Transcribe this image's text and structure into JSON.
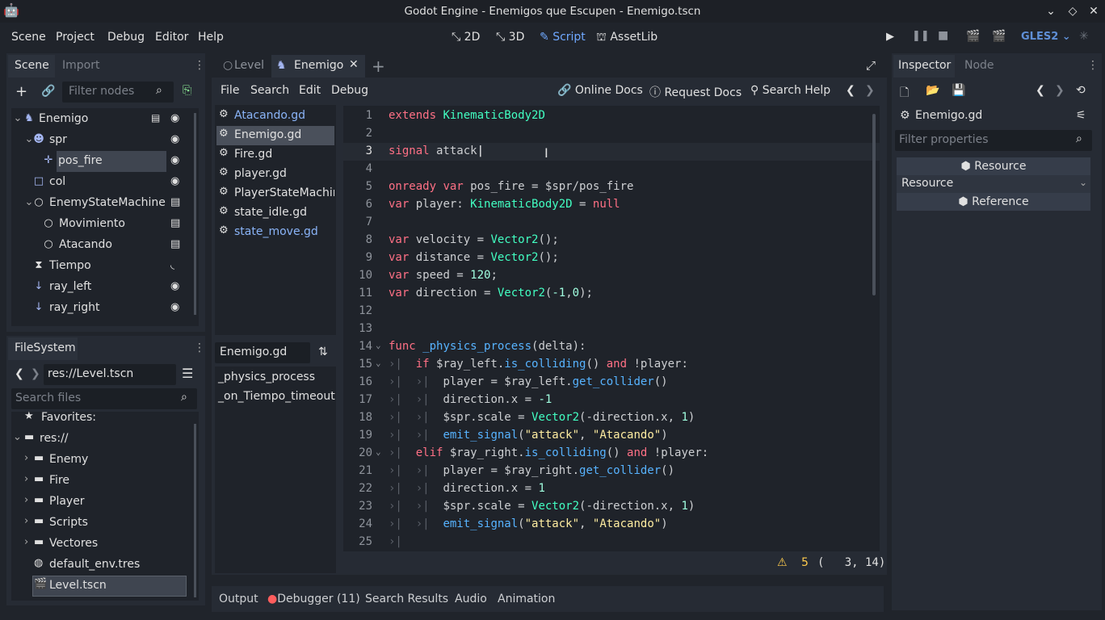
{
  "window": {
    "title": "Godot Engine - Enemigos que Escupen - Enemigo.tscn",
    "buttons": {
      "minimize": "⌄",
      "maximize": "◇",
      "close": "✕"
    }
  },
  "menu": [
    "Scene",
    "Project",
    "Debug",
    "Editor",
    "Help"
  ],
  "workspaces": [
    {
      "label": "2D",
      "icon": "2d-icon"
    },
    {
      "label": "3D",
      "icon": "3d-icon"
    },
    {
      "label": "Script",
      "icon": "script-icon",
      "active": true
    },
    {
      "label": "AssetLib",
      "icon": "assetlib-icon"
    }
  ],
  "renderer": "GLES2",
  "scene_dock": {
    "tabs": [
      "Scene",
      "Import"
    ],
    "filter_placeholder": "Filter nodes",
    "nodes": [
      {
        "label": "Enemigo",
        "icon": "kinematic-body-icon"
      },
      {
        "label": "spr",
        "icon": "sprite-icon"
      },
      {
        "label": "pos_fire",
        "icon": "position2d-icon"
      },
      {
        "label": "col",
        "icon": "collision-icon"
      },
      {
        "label": "EnemyStateMachine",
        "icon": "node-icon"
      },
      {
        "label": "Movimiento",
        "icon": "node-icon"
      },
      {
        "label": "Atacando",
        "icon": "node-icon"
      },
      {
        "label": "Tiempo",
        "icon": "timer-icon"
      },
      {
        "label": "ray_left",
        "icon": "raycast-icon"
      },
      {
        "label": "ray_right",
        "icon": "raycast-icon"
      }
    ]
  },
  "filesystem": {
    "tab": "FileSystem",
    "path": "res://Level.tscn",
    "search_placeholder": "Search files",
    "items": [
      {
        "label": "Favorites:",
        "icon": "star-icon"
      },
      {
        "label": "res://",
        "icon": "folder-icon"
      },
      {
        "label": "Enemy",
        "icon": "folder-icon"
      },
      {
        "label": "Fire",
        "icon": "folder-icon"
      },
      {
        "label": "Player",
        "icon": "folder-icon"
      },
      {
        "label": "Scripts",
        "icon": "folder-icon"
      },
      {
        "label": "Vectores",
        "icon": "folder-icon"
      },
      {
        "label": "default_env.tres",
        "icon": "environment-icon"
      },
      {
        "label": "Level.tscn",
        "icon": "scene-icon"
      }
    ]
  },
  "editor_tabs": [
    {
      "label": "Level"
    },
    {
      "label": "Enemigo",
      "active": true
    }
  ],
  "script_menu": [
    "File",
    "Search",
    "Edit",
    "Debug"
  ],
  "script_toolbar": [
    "Online Docs",
    "Request Docs",
    "Search Help"
  ],
  "script_list": [
    "Atacando.gd",
    "Enemigo.gd",
    "Fire.gd",
    "player.gd",
    "PlayerStateMachine.gd",
    "state_idle.gd",
    "state_move.gd"
  ],
  "method_panel": {
    "title": "Enemigo.gd",
    "methods": [
      "_physics_process",
      "_on_Tiempo_timeout"
    ]
  },
  "code_lines": [
    "1",
    "2",
    "3",
    "4",
    "5",
    "6",
    "7",
    "8",
    "9",
    "10",
    "11",
    "12",
    "13",
    "14",
    "15",
    "16",
    "17",
    "18",
    "19",
    "20",
    "21",
    "22",
    "23",
    "24",
    "25"
  ],
  "status": {
    "warnings": "5",
    "position": "(   3, 14)"
  },
  "inspector": {
    "tabs": [
      "Inspector",
      "Node"
    ],
    "object": "Enemigo.gd",
    "filter_placeholder": "Filter properties",
    "resource_header": "Resource",
    "resource_section": "Resource",
    "reference_header": "Reference"
  },
  "bottom_tabs": [
    "Output",
    "Debugger (11)",
    "Search Results",
    "Audio",
    "Animation"
  ]
}
